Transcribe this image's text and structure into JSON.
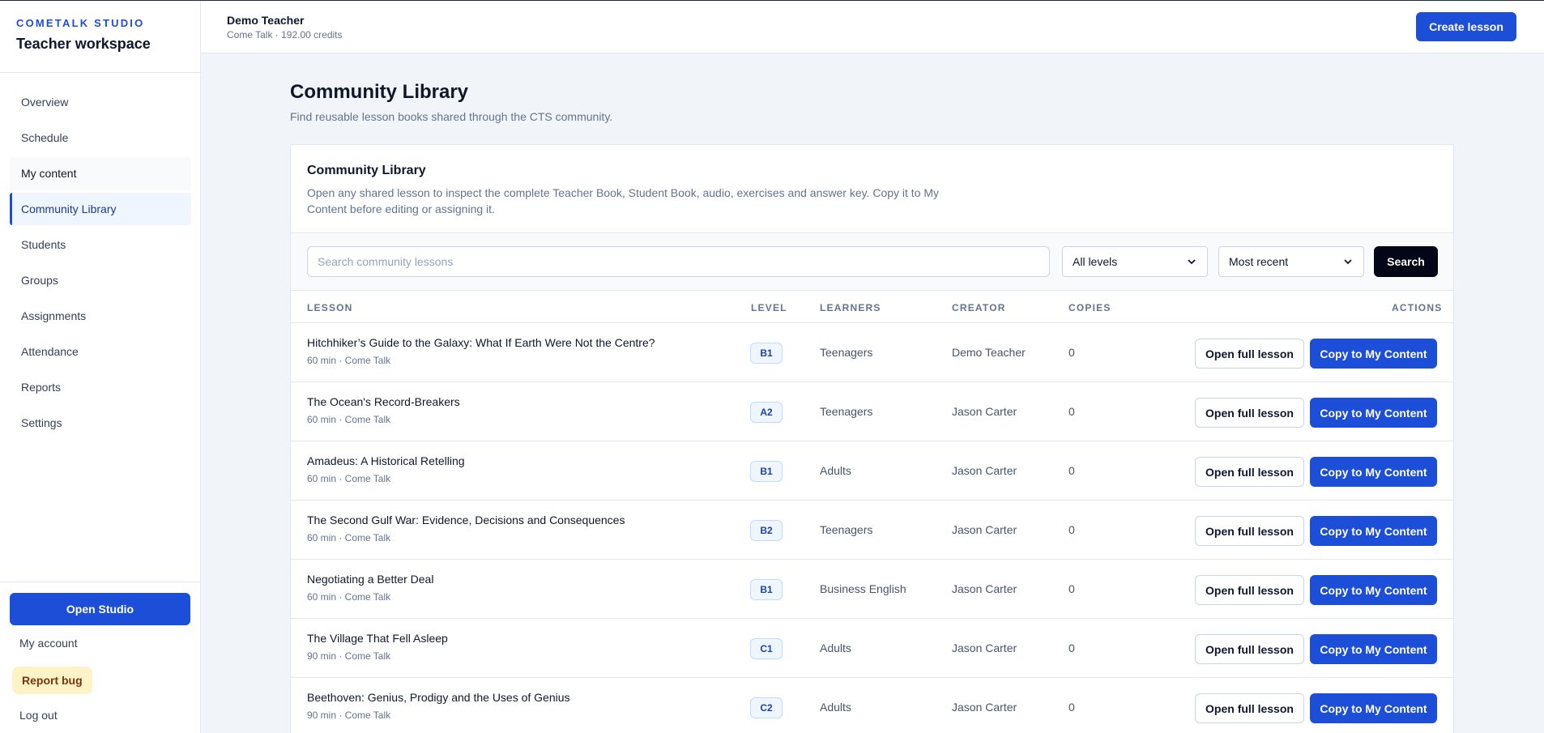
{
  "sidebar": {
    "brand_kicker": "COMETALK STUDIO",
    "brand_title": "Teacher workspace",
    "items": [
      {
        "label": "Overview"
      },
      {
        "label": "Schedule"
      },
      {
        "label": "My content"
      },
      {
        "label": "Community Library"
      },
      {
        "label": "Students"
      },
      {
        "label": "Groups"
      },
      {
        "label": "Assignments"
      },
      {
        "label": "Attendance"
      },
      {
        "label": "Reports"
      },
      {
        "label": "Settings"
      }
    ],
    "active_item": "Community Library",
    "open_studio": "Open Studio",
    "my_account": "My account",
    "report_bug": "Report bug",
    "log_out": "Log out"
  },
  "header": {
    "user_name": "Demo Teacher",
    "user_sub": "Come Talk · 192.00 credits",
    "create_lesson": "Create lesson"
  },
  "page": {
    "title": "Community Library",
    "subtitle": "Find reusable lesson books shared through the CTS community."
  },
  "panel": {
    "title": "Community Library",
    "description": "Open any shared lesson to inspect the complete Teacher Book, Student Book, audio, exercises and answer key. Copy it to My Content before editing or assigning it."
  },
  "filters": {
    "search_placeholder": "Search community lessons",
    "level_selected": "All levels",
    "sort_selected": "Most recent",
    "search_button": "Search"
  },
  "table": {
    "headers": {
      "lesson": "LESSON",
      "level": "LEVEL",
      "learners": "LEARNERS",
      "creator": "CREATOR",
      "copies": "COPIES",
      "actions": "ACTIONS"
    },
    "open_label": "Open full lesson",
    "copy_label": "Copy to My Content",
    "rows": [
      {
        "title": "Hitchhiker’s Guide to the Galaxy: What If Earth Were Not the Centre?",
        "meta": "60 min · Come Talk",
        "level": "B1",
        "learners": "Teenagers",
        "creator": "Demo Teacher",
        "copies": "0"
      },
      {
        "title": "The Ocean's Record-Breakers",
        "meta": "60 min · Come Talk",
        "level": "A2",
        "learners": "Teenagers",
        "creator": "Jason Carter",
        "copies": "0"
      },
      {
        "title": "Amadeus: A Historical Retelling",
        "meta": "60 min · Come Talk",
        "level": "B1",
        "learners": "Adults",
        "creator": "Jason Carter",
        "copies": "0"
      },
      {
        "title": "The Second Gulf War: Evidence, Decisions and Consequences",
        "meta": "60 min · Come Talk",
        "level": "B2",
        "learners": "Teenagers",
        "creator": "Jason Carter",
        "copies": "0"
      },
      {
        "title": "Negotiating a Better Deal",
        "meta": "60 min · Come Talk",
        "level": "B1",
        "learners": "Business English",
        "creator": "Jason Carter",
        "copies": "0"
      },
      {
        "title": "The Village That Fell Asleep",
        "meta": "90 min · Come Talk",
        "level": "C1",
        "learners": "Adults",
        "creator": "Jason Carter",
        "copies": "0"
      },
      {
        "title": "Beethoven: Genius, Prodigy and the Uses of Genius",
        "meta": "90 min · Come Talk",
        "level": "C2",
        "learners": "Adults",
        "creator": "Jason Carter",
        "copies": "0"
      }
    ]
  },
  "colors": {
    "accent": "#1d4ed8",
    "dark_button": "#020617",
    "bug_bg": "#fef3c7"
  }
}
